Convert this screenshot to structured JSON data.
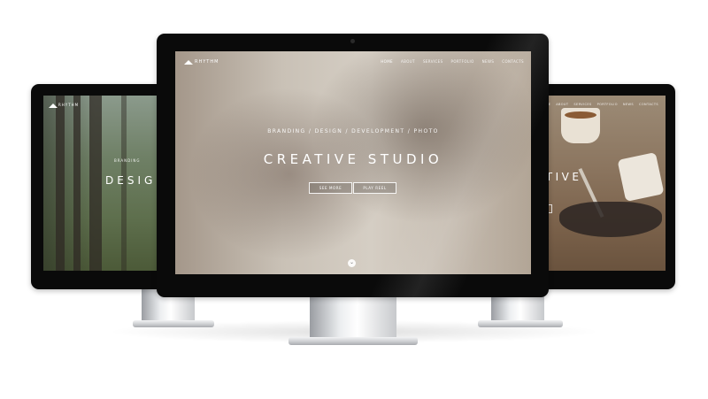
{
  "center_site": {
    "logo_text": "RHYTHM",
    "nav": [
      "HOME",
      "ABOUT",
      "SERVICES",
      "PORTFOLIO",
      "NEWS",
      "CONTACTS"
    ],
    "active_nav": "HOME",
    "tagline": "BRANDING / DESIGN / DEVELOPMENT / PHOTO",
    "title": "CREATIVE STUDIO",
    "buttons": {
      "see_more": "SEE MORE",
      "play_reel": "PLAY REEL"
    },
    "scroll_icon": "chevron-down-icon"
  },
  "left_site": {
    "logo_text": "RHYTHM",
    "tagline": "BRANDING",
    "title": "DESIGN"
  },
  "right_site": {
    "nav": [
      "HOME",
      "ABOUT",
      "SERVICES",
      "PORTFOLIO",
      "NEWS",
      "CONTACTS"
    ],
    "title": "ATIVE"
  },
  "colors": {
    "bezel": "#0a0a0a",
    "stand": "#d9dbde",
    "text_on_image": "#ffffff"
  }
}
